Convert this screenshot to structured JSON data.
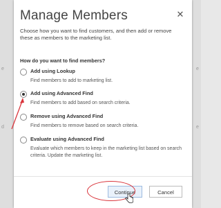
{
  "background": {
    "left_fragments": [
      "e",
      "d"
    ],
    "right_fragments": [
      "e",
      "e"
    ]
  },
  "dialog": {
    "title": "Manage Members",
    "subtitle": "Choose how you want to find customers, and then add or remove these as members to the marketing list.",
    "question": "How do you want to find members?",
    "close_icon": "close-icon",
    "options": [
      {
        "label": "Add using Lookup",
        "description": "Find members to add to marketing list.",
        "checked": false
      },
      {
        "label": "Add using Advanced Find",
        "description": "Find members to add based on search criteria.",
        "checked": true
      },
      {
        "label": "Remove using Advanced Find",
        "description": "Find members to remove based on search criteria.",
        "checked": false
      },
      {
        "label": "Evaluate using Advanced Find",
        "description": "Evaluate which members to keep in the marketing list based on search criteria. Update the marketing list.",
        "checked": false
      }
    ],
    "buttons": {
      "continue": "Continue",
      "cancel": "Cancel"
    }
  },
  "colors": {
    "annotation_red": "#d9333a",
    "continue_bg": "#e9f1fb",
    "continue_border": "#9dbbe0"
  }
}
